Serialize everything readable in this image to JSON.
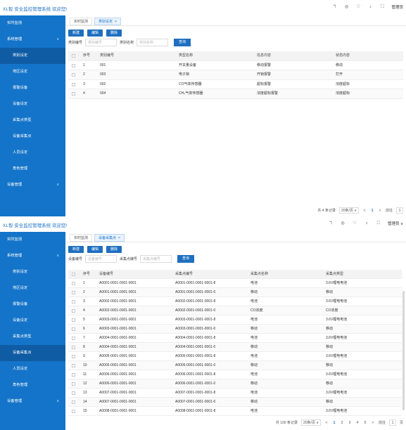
{
  "app": {
    "title": "XL智 安全监控管理系统 欢迎您!",
    "user": "管理员",
    "user_with_menu": "管理员 ∨",
    "icons": [
      "tree-icon",
      "dashboard-icon",
      "shield-icon",
      "notification-icon",
      "fullscreen-icon"
    ],
    "icon_glyphs": [
      "ℸ",
      "◎",
      "♡",
      "♪",
      "⛶"
    ],
    "accent": "#1474c9"
  },
  "sidebar_top": {
    "realtime": "实时监测",
    "system": "系统管理",
    "subs": [
      "类别设定",
      "地区设定",
      "报警设备",
      "设备设定",
      "采集点类型",
      "设备采集点",
      "人员设定",
      "角色管理"
    ],
    "device": "设备管理",
    "chevron_down": "∨",
    "chevron_up": "∧"
  },
  "screen1": {
    "tabs": [
      {
        "label": "实时监测"
      },
      {
        "label": "类别设定"
      }
    ],
    "tab_close": "×",
    "actions": {
      "add": "新建",
      "edit": "编辑",
      "delete": "删除"
    },
    "filters": {
      "label1": "类别编号",
      "placeholder1": "类别编号",
      "label2": "类别名称",
      "placeholder2": "类别名称",
      "query": "查询"
    },
    "table": {
      "headers": {
        "no": "序号",
        "a": "类别编号",
        "b": "类型名称",
        "c": "信息内容",
        "d": "状态内容"
      },
      "rows": [
        {
          "no": "1",
          "a": "001",
          "b": "开关量设备",
          "c": "移动报警",
          "d": "移动"
        },
        {
          "no": "2",
          "a": "003",
          "b": "电子锁",
          "c": "开锁报警",
          "d": "打开"
        },
        {
          "no": "3",
          "a": "002",
          "b": "CO气体传感器",
          "c": "超标报警",
          "d": "浓度超标"
        },
        {
          "no": "4",
          "a": "004",
          "b": "CH₄气体传感器",
          "c": "浓度超标报警",
          "d": "浓度超标"
        }
      ]
    },
    "pager": {
      "total": "共 4 条记录",
      "page_size": "20条/页 ∨",
      "prev": "<",
      "pages": [
        "1"
      ],
      "next": ">",
      "goto": "前往",
      "goto_value": "1"
    }
  },
  "screen2": {
    "tabs": [
      {
        "label": "实时监测"
      },
      {
        "label": "设备采集点"
      }
    ],
    "tab_close": "×",
    "actions": {
      "add": "新建",
      "edit": "编辑",
      "delete": "删除"
    },
    "filters": {
      "label1": "设备编号",
      "placeholder1": "设备编号",
      "label2": "采集点编号",
      "placeholder2": "采集点编号",
      "query": "查询"
    },
    "table": {
      "headers": {
        "no": "序号",
        "a": "设备编号",
        "b": "采集点编号",
        "c": "采集点名称",
        "d": "采集点类型"
      },
      "rows": [
        {
          "no": "1",
          "a": "A0001-0001-0001-0001",
          "b": "A0001-0001-0001-0001-8",
          "c": "电池",
          "d": "3.6V锂电电池"
        },
        {
          "no": "2",
          "a": "A0001-0001-0001-0001",
          "b": "A0001-0001-0001-0001-0",
          "c": "移动",
          "d": "移动"
        },
        {
          "no": "3",
          "a": "A0002-0001-0001-0001",
          "b": "A0002-0001-0001-0001-8",
          "c": "电池",
          "d": "3.6V锂电电池"
        },
        {
          "no": "4",
          "a": "A0002-0001-0001-0001",
          "b": "A0002-0001-0001-0001-0",
          "c": "CO浓度",
          "d": "CO浓度"
        },
        {
          "no": "5",
          "a": "A0003-0001-0001-0001",
          "b": "A0003-0001-0001-0001-8",
          "c": "电池",
          "d": "3.6V锂电电池"
        },
        {
          "no": "6",
          "a": "A0003-0001-0001-0001",
          "b": "A0003-0001-0001-0001-0",
          "c": "移动",
          "d": "移动"
        },
        {
          "no": "7",
          "a": "A0004-0001-0001-0001",
          "b": "A0004-0001-0001-0001-8",
          "c": "电池",
          "d": "3.6V锂电电池"
        },
        {
          "no": "8",
          "a": "A0004-0001-0001-0001",
          "b": "A0004-0001-0001-0001-0",
          "c": "移动",
          "d": "移动"
        },
        {
          "no": "9",
          "a": "A0005-0001-0001-0001",
          "b": "A0005-0001-0001-0001-8",
          "c": "电池",
          "d": "3.6V锂电电池"
        },
        {
          "no": "10",
          "a": "A0005-0001-0001-0001",
          "b": "A0005-0001-0001-0001-0",
          "c": "移动",
          "d": "移动"
        },
        {
          "no": "11",
          "a": "A0006-0001-0001-0001",
          "b": "A0006-0001-0001-0001-8",
          "c": "电池",
          "d": "3.6V锂电电池"
        },
        {
          "no": "12",
          "a": "A0006-0001-0001-0001",
          "b": "A0006-0001-0001-0001-0",
          "c": "移动",
          "d": "移动"
        },
        {
          "no": "13",
          "a": "A0007-0001-0001-0001",
          "b": "A0007-0001-0001-0001-8",
          "c": "电池",
          "d": "3.6V锂电电池"
        },
        {
          "no": "14",
          "a": "A0007-0001-0001-0001",
          "b": "A0007-0001-0001-0001-0",
          "c": "移动",
          "d": "移动"
        },
        {
          "no": "15",
          "a": "A0008-0001-0001-0001",
          "b": "A0008-0001-0001-0001-8",
          "c": "电池",
          "d": "3.6V锂电电池"
        }
      ]
    },
    "pager": {
      "total": "共 100 条记录",
      "page_size": "20条/页 ∨",
      "prev": "<",
      "pages": [
        "1",
        "2",
        "3",
        "4",
        "5"
      ],
      "next": ">",
      "goto": "前往",
      "goto_value": "1",
      "page_unit": "页"
    }
  }
}
